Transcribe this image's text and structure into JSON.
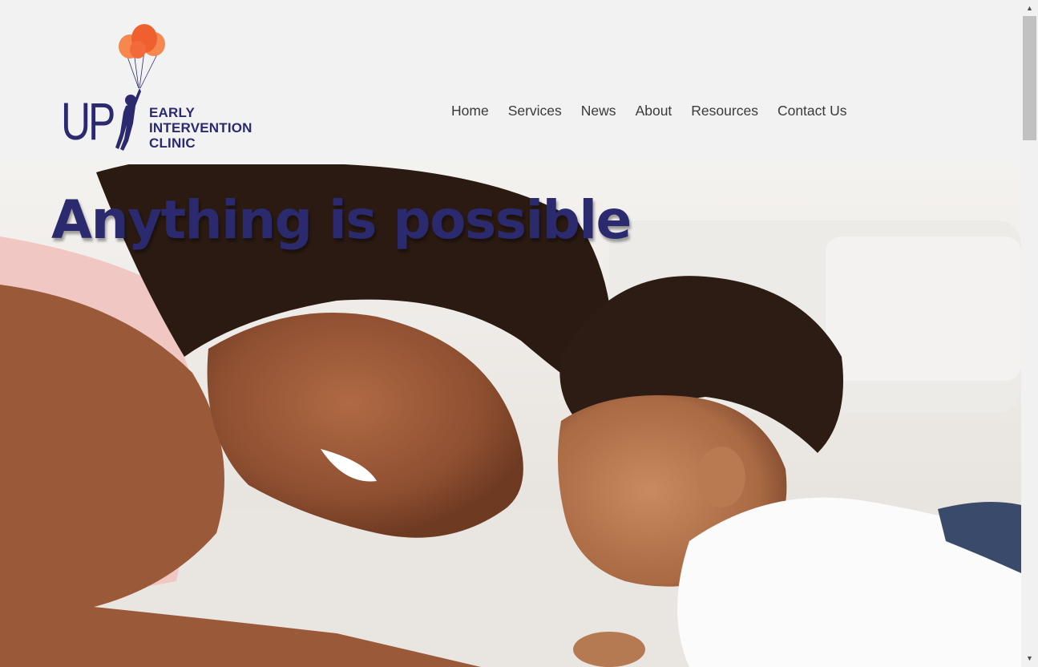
{
  "logo": {
    "mark": "UP",
    "lines": [
      "EARLY",
      "INTERVENTION",
      "CLINIC"
    ],
    "balloon_color": "#f26a3a",
    "brand_color": "#2b2a6e"
  },
  "nav": {
    "items": [
      {
        "label": "Home"
      },
      {
        "label": "Services"
      },
      {
        "label": "News"
      },
      {
        "label": "About"
      },
      {
        "label": "Resources"
      },
      {
        "label": "Contact Us"
      }
    ]
  },
  "hero": {
    "title": "Anything is possible",
    "image": "photo of a smiling woman and a baby face to face"
  },
  "scrollbar": {
    "up_icon": "arrow-up-icon",
    "down_icon": "arrow-down-icon"
  }
}
